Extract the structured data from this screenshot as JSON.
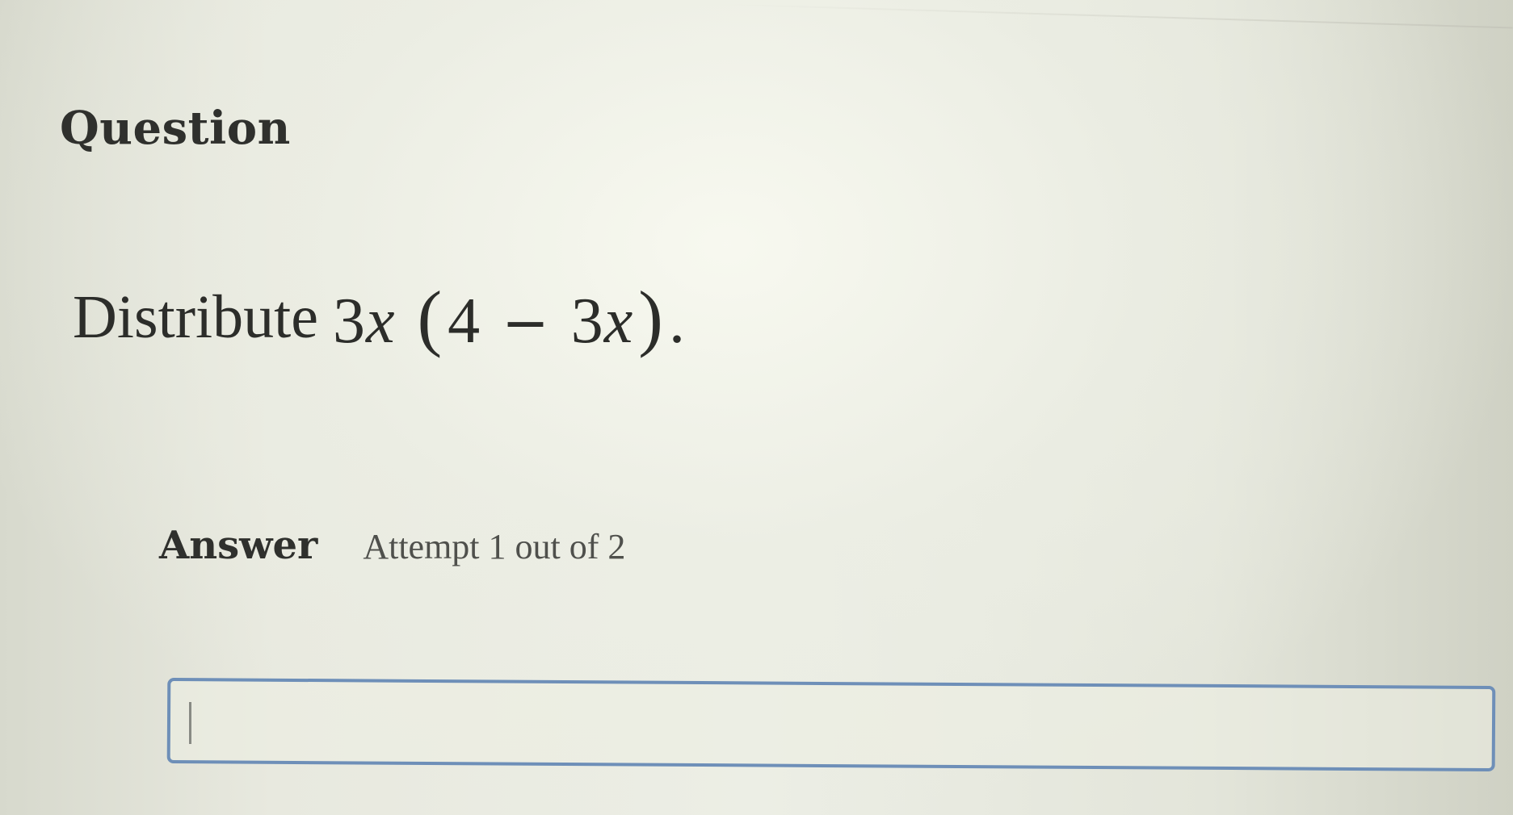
{
  "question": {
    "heading": "Question",
    "prompt_text": "Distribute",
    "expression": {
      "coefficient": "3",
      "variable": "x",
      "open_paren": "(",
      "term_a": "4",
      "operator": "−",
      "term_b_coefficient": "3",
      "term_b_variable": "x",
      "close_paren": ")",
      "period": "."
    }
  },
  "answer": {
    "label": "Answer",
    "attempt_text": "Attempt 1 out of 2",
    "input_value": "",
    "input_placeholder": ""
  },
  "colors": {
    "input_border": "#6e8fb8",
    "text": "#2f302d",
    "background": "#e2e3d8"
  }
}
